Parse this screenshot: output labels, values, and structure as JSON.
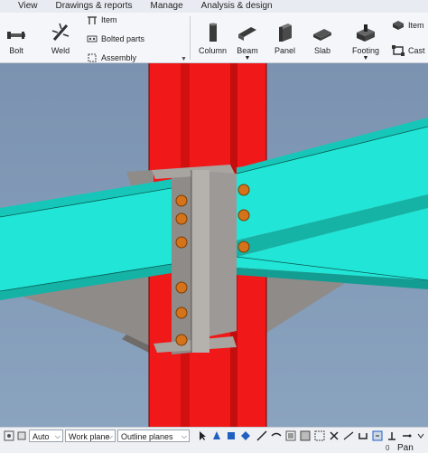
{
  "menu": [
    "View",
    "Drawings & reports",
    "Manage",
    "Analysis & design"
  ],
  "ribbon": {
    "bolt": "Bolt",
    "weld": "Weld",
    "item": "Item",
    "bolted_parts": "Bolted parts",
    "assembly": "Assembly",
    "column": "Column",
    "beam": "Beam",
    "panel": "Panel",
    "slab": "Slab",
    "footing": "Footing",
    "item_right": "Item",
    "cast": "Cast"
  },
  "status": {
    "combo1": "Auto",
    "combo2": "Work plane",
    "combo3": "Outline planes"
  },
  "bottom": {
    "zero": "0",
    "mode": "Pan"
  },
  "colors": {
    "column": "#f01818",
    "beam": "#21e5d6",
    "plate": "#8f8b88",
    "bolt": "#d4731a",
    "background": "#7f98b4"
  }
}
